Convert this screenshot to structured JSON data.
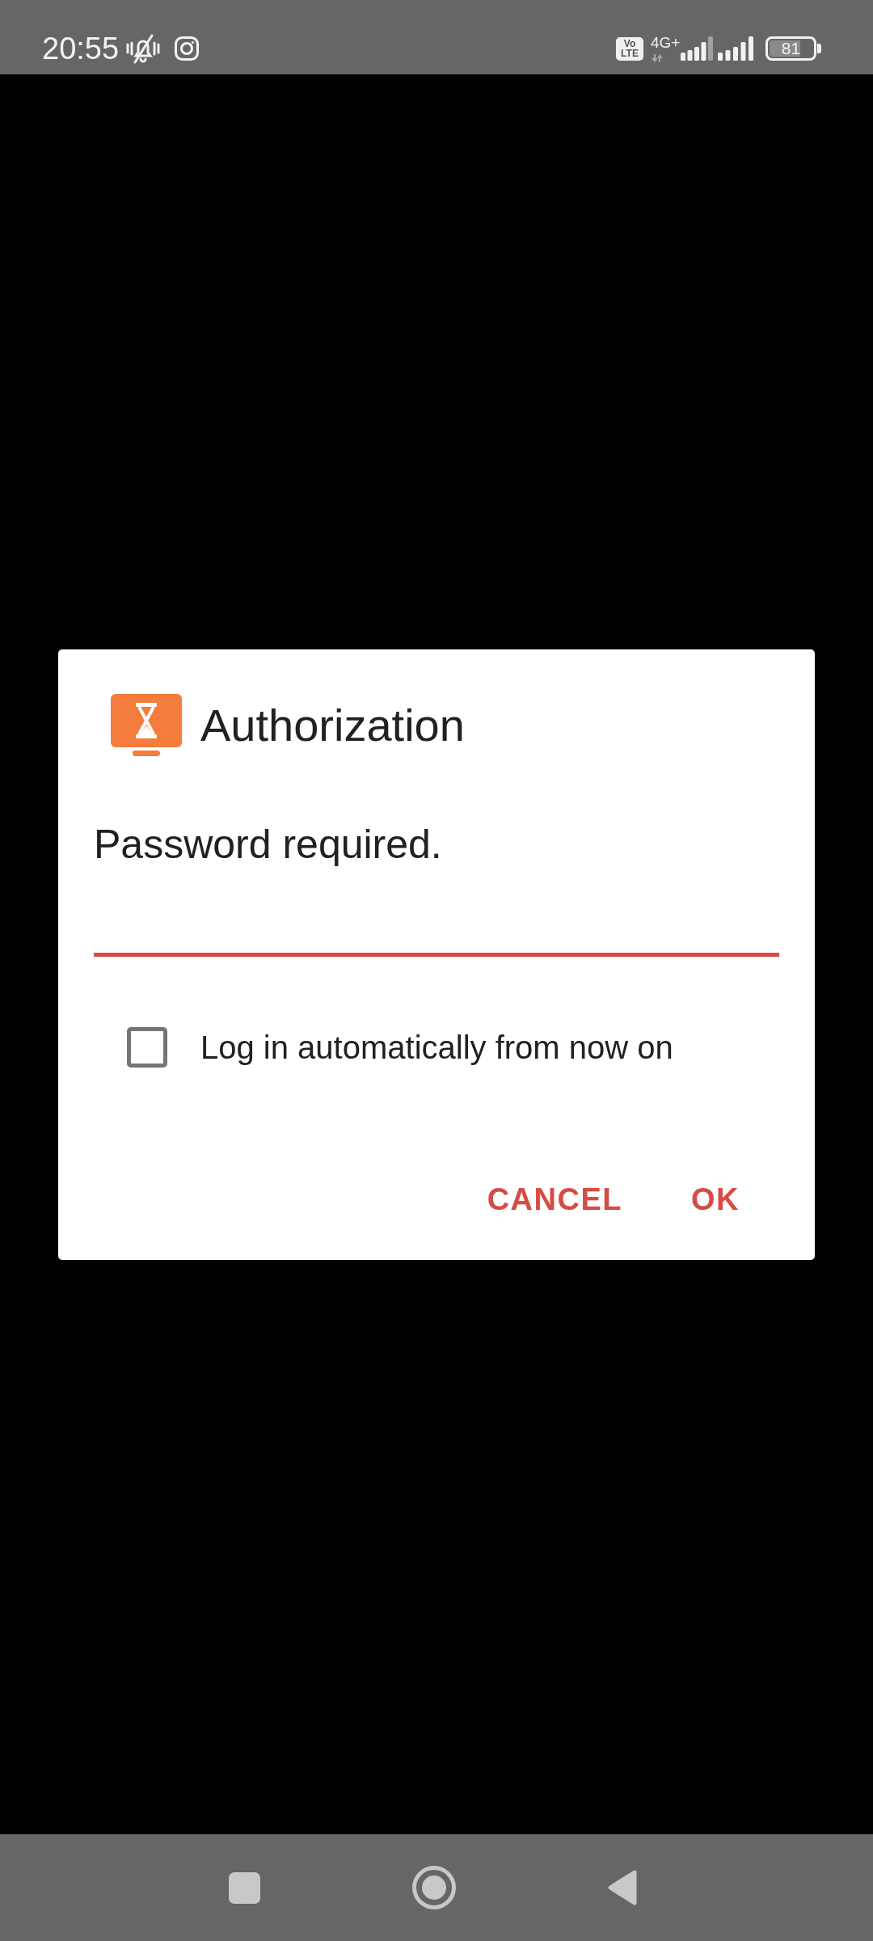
{
  "status_bar": {
    "time": "20:55",
    "volte_badge": "Vo LTE",
    "network_type": "4G+",
    "battery": "81"
  },
  "dialog": {
    "title": "Authorization",
    "message": "Password required.",
    "password_field": {
      "focused": true
    },
    "checkbox": {
      "label": "Log in automatically from now on",
      "checked": false
    },
    "buttons": [
      {
        "label": "CANCEL"
      },
      {
        "label": "OK"
      }
    ]
  }
}
